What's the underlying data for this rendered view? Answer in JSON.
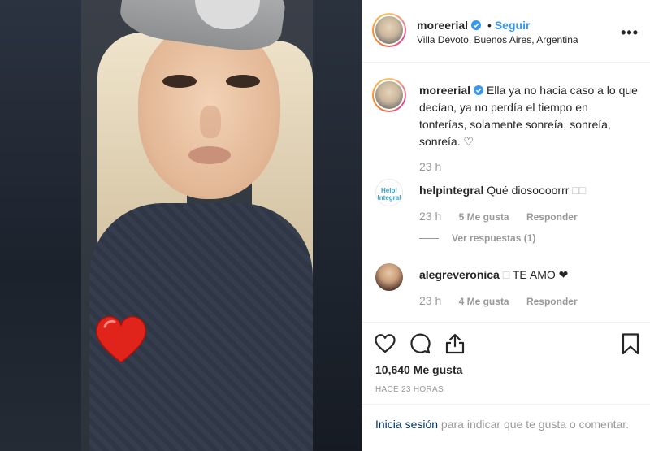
{
  "post": {
    "username": "moreerial",
    "follow_label": "Seguir",
    "separator": "•",
    "location": "Villa Devoto, Buenos Aires, Argentina",
    "more_label": "•••",
    "caption": "Ella ya no hacia caso a lo que decían, ya no perdía el tiempo en tonterías, solamente sonreía, sonreía, sonreía. ♡",
    "caption_time": "23 h"
  },
  "comments": [
    {
      "username": "helpintegral",
      "text": "Qué diosoooorrr",
      "text_suffix": "□□",
      "avatar_text": "Help! Integral",
      "time": "23 h",
      "likes": "5 Me gusta",
      "reply_label": "Responder",
      "view_replies": "Ver respuestas (1)"
    },
    {
      "username": "alegreveronica",
      "text_prefix": "□",
      "text": "TE AMO ❤",
      "time": "23 h",
      "likes": "4 Me gusta",
      "reply_label": "Responder"
    }
  ],
  "actions": {
    "icons": [
      "heart-outline-icon",
      "comment-bubble-icon",
      "share-upload-icon",
      "bookmark-icon"
    ],
    "likes_count": "10,640 Me gusta",
    "posted_ago": "HACE 23 HORAS"
  },
  "login_prompt": {
    "link": "Inicia sesión",
    "rest": " para indicar que te gusta o comentar."
  },
  "colors": {
    "link_blue": "#3897f0",
    "dark_link": "#003569",
    "muted": "#999999",
    "text": "#262626",
    "heart_red": "#e0241b"
  }
}
